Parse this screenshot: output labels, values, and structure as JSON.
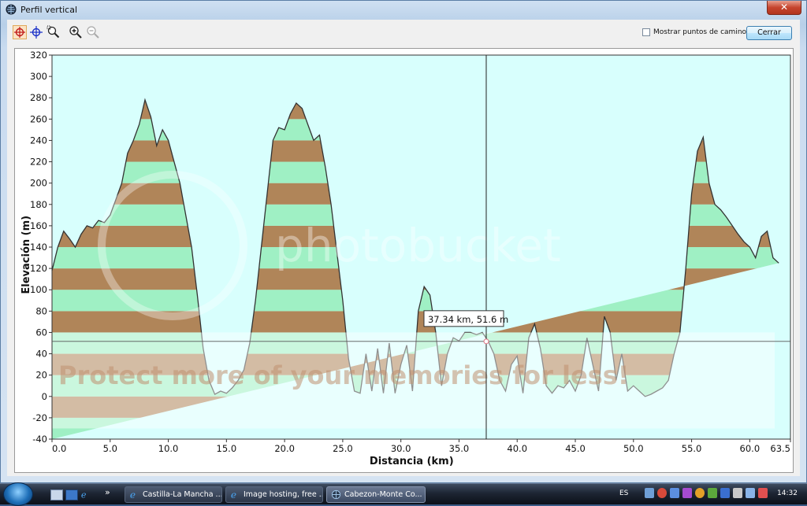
{
  "window": {
    "title": "Perfil vertical",
    "close_glyph": "✕"
  },
  "toolbar": {
    "tools": [
      "cursor-crosshair-icon",
      "crosshair-icon",
      "zoom-window-icon",
      "zoom-in-icon",
      "zoom-out-icon"
    ],
    "show_waypoints_label": "Mostrar puntos de camino",
    "show_waypoints_checked": false,
    "close_label": "Cerrar"
  },
  "chart_data": {
    "type": "area",
    "xlabel": "Distancia   (km)",
    "ylabel": "Elevación (m)",
    "xlim": [
      0,
      63.5
    ],
    "ylim": [
      -40,
      320
    ],
    "x_ticks": [
      0,
      5,
      10,
      15,
      20,
      25,
      30,
      35,
      40,
      45,
      50,
      55,
      60,
      63.5
    ],
    "x_tick_labels": [
      "0.0",
      "5.0",
      "10.0",
      "15.0",
      "20.0",
      "25.0",
      "30.0",
      "35.0",
      "40.0",
      "45.0",
      "50.0",
      "55.0",
      "60.0",
      "63.5"
    ],
    "y_ticks": [
      -40,
      -20,
      0,
      20,
      40,
      60,
      80,
      100,
      120,
      140,
      160,
      180,
      200,
      220,
      240,
      260,
      280,
      300,
      320
    ],
    "band_colors": [
      "#9ff0c4",
      "#b08559"
    ],
    "background": "#d8fffd",
    "cursor": {
      "x": 37.34,
      "y": 51.6,
      "label": "37.34 km, 51.6 m"
    },
    "x": [
      0,
      0.5,
      1,
      1.5,
      2,
      2.5,
      3,
      3.5,
      4,
      4.5,
      5,
      5.5,
      6,
      6.5,
      7,
      7.5,
      8,
      8.5,
      9,
      9.5,
      10,
      10.5,
      11,
      11.5,
      12,
      12.5,
      13,
      13.5,
      14,
      14.5,
      15,
      15.5,
      16,
      16.5,
      17,
      17.5,
      18,
      18.5,
      19,
      19.5,
      20,
      20.5,
      21,
      21.5,
      22,
      22.5,
      23,
      23.5,
      24,
      24.5,
      25,
      25.5,
      26,
      26.5,
      27,
      27.5,
      28,
      28.5,
      29,
      29.5,
      30,
      30.5,
      31,
      31.5,
      32,
      32.5,
      33,
      33.5,
      34,
      34.5,
      35,
      35.5,
      36,
      36.5,
      37,
      37.5,
      38,
      38.5,
      39,
      39.5,
      40,
      40.5,
      41,
      41.5,
      42,
      42.5,
      43,
      43.5,
      44,
      44.5,
      45,
      45.5,
      46,
      46.5,
      47,
      47.5,
      48,
      48.5,
      49,
      49.5,
      50,
      50.5,
      51,
      51.5,
      52,
      52.5,
      53,
      53.5,
      54,
      54.5,
      55,
      55.5,
      56,
      56.5,
      57,
      57.5,
      58,
      58.5,
      59,
      59.5,
      60,
      60.5,
      61,
      61.5,
      62,
      62.5,
      63,
      63.5
    ],
    "y": [
      118,
      140,
      155,
      148,
      140,
      152,
      160,
      158,
      165,
      163,
      170,
      185,
      200,
      228,
      240,
      255,
      278,
      262,
      235,
      250,
      240,
      220,
      200,
      170,
      140,
      95,
      45,
      15,
      2,
      5,
      3,
      8,
      15,
      25,
      50,
      90,
      140,
      190,
      240,
      252,
      250,
      265,
      275,
      270,
      255,
      240,
      245,
      215,
      180,
      135,
      90,
      35,
      5,
      3,
      40,
      5,
      45,
      3,
      50,
      3,
      30,
      48,
      5,
      80,
      103,
      95,
      60,
      10,
      40,
      55,
      52,
      60,
      60,
      58,
      60,
      52,
      40,
      15,
      5,
      30,
      38,
      3,
      55,
      68,
      45,
      10,
      3,
      10,
      8,
      15,
      5,
      20,
      55,
      30,
      5,
      75,
      60,
      15,
      40,
      5,
      10,
      5,
      0,
      2,
      5,
      8,
      15,
      40,
      60,
      120,
      190,
      230,
      243,
      200,
      180,
      175,
      168,
      160,
      152,
      145,
      140,
      130,
      150,
      155,
      130,
      125
    ]
  },
  "watermark": {
    "brand": "photobucket",
    "tagline": "Protect more of your memories for less!"
  },
  "taskbar": {
    "overflow_glyph": "»",
    "buttons": [
      {
        "label": "Castilla-La Mancha ...",
        "icon": "ie-icon",
        "active": false
      },
      {
        "label": "Image hosting, free ...",
        "icon": "ie-icon",
        "active": false
      },
      {
        "label": "Cabezon-Monte Co...",
        "icon": "globe-icon",
        "active": true
      }
    ],
    "language": "ES",
    "clock": "14:32"
  }
}
